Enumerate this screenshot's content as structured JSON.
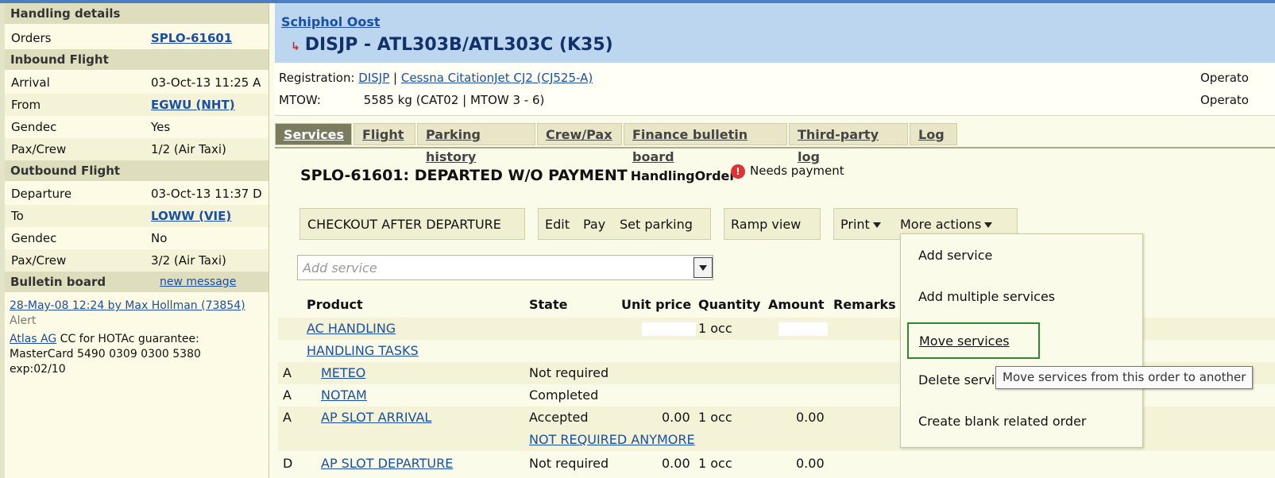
{
  "sidebar": {
    "handling_header": "Handling details",
    "orders_label": "Orders",
    "orders_value": "SPLO-61601",
    "inbound_header": "Inbound Flight",
    "inbound": [
      {
        "label": "Arrival",
        "value": "03-Oct-13 11:25 A"
      },
      {
        "label": "From",
        "value": "EGWU (NHT)"
      },
      {
        "label": "Gendec",
        "value": "Yes"
      },
      {
        "label": "Pax/Crew",
        "value": "1/2 (Air Taxi)"
      }
    ],
    "outbound_header": "Outbound Flight",
    "outbound": [
      {
        "label": "Departure",
        "value": "03-Oct-13 11:37 D"
      },
      {
        "label": "To",
        "value": "LOWW (VIE)"
      },
      {
        "label": "Gendec",
        "value": "No"
      },
      {
        "label": "Pax/Crew",
        "value": "3/2 (Air Taxi)"
      }
    ],
    "bulletin_header": "Bulletin board",
    "new_message": "new message",
    "note_author": "28-May-08 12:24 by Max Hollman (73854)",
    "note_type": "Alert",
    "note_company": "Atlas AG",
    "note_text_1": " CC for HOTAc guarantee:",
    "note_text_2": "MasterCard 5490 0309 0300 5380",
    "note_text_3": "exp:02/10"
  },
  "header": {
    "breadcrumb": "Schiphol Oost",
    "title": "DISJP - ATL303B/ATL303C (K35)"
  },
  "aircraft": {
    "registration_label": "Registration:",
    "registration": "DISJP",
    "separator": " | ",
    "type": "Cessna CitationJet CJ2 (CJ525-A)",
    "mtow_label": "MTOW:",
    "mtow": "5585 kg (CAT02 | MTOW 3 - 6)",
    "operator_1": "Operato",
    "operator_2": "Operato"
  },
  "tabs": [
    "Services",
    "Flight",
    "Parking history",
    "Crew/Pax",
    "Finance bulletin board",
    "Third-party log",
    "Log"
  ],
  "order": {
    "title": "SPLO-61601: DEPARTED W/O PAYMENT",
    "subtitle": "HandlingOrder",
    "badge_icon": "!",
    "badge": "Needs payment"
  },
  "actions": {
    "checkout": "CHECKOUT AFTER DEPARTURE",
    "edit": "Edit",
    "pay": "Pay",
    "set_parking": "Set parking",
    "ramp_view": "Ramp view",
    "print": "Print",
    "more_actions": "More actions"
  },
  "add_service": {
    "placeholder": "Add service"
  },
  "table": {
    "headers": [
      "Product",
      "State",
      "Unit price",
      "Quantity",
      "Amount",
      "Remarks"
    ],
    "rows": [
      {
        "prefix": "",
        "product": "AC HANDLING",
        "state": "",
        "unit_price": "",
        "quantity": "1 occ",
        "amount": ""
      },
      {
        "prefix": "",
        "product": "HANDLING TASKS",
        "state": "",
        "unit_price": "",
        "quantity": "",
        "amount": ""
      },
      {
        "prefix": "A",
        "product": "METEO",
        "state": "Not required",
        "unit_price": "",
        "quantity": "",
        "amount": ""
      },
      {
        "prefix": "A",
        "product": "NOTAM",
        "state": "Completed",
        "unit_price": "",
        "quantity": "",
        "amount": ""
      },
      {
        "prefix": "A",
        "product": "AP SLOT ARRIVAL",
        "state": "Accepted",
        "unit_price": "0.00",
        "quantity": "1 occ",
        "amount": "0.00"
      },
      {
        "prefix": "",
        "product": "",
        "state": "NOT REQUIRED ANYMORE",
        "unit_price": "",
        "quantity": "",
        "amount": ""
      },
      {
        "prefix": "D",
        "product": "AP SLOT DEPARTURE",
        "state": "Not required",
        "unit_price": "0.00",
        "quantity": "1 occ",
        "amount": "0.00"
      }
    ]
  },
  "menu": {
    "items": [
      "Add service",
      "Add multiple services",
      "Move services",
      "Delete servic",
      "Create blank related order"
    ]
  },
  "tooltip": "Move services from this order to another"
}
